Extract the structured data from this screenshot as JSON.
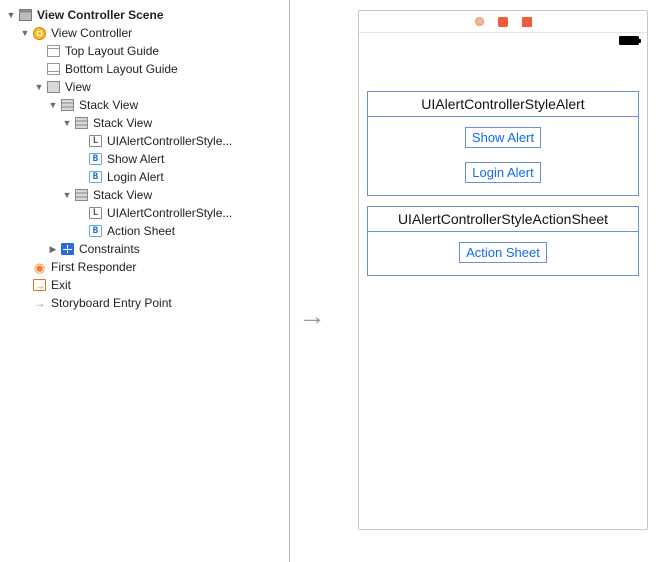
{
  "outline": {
    "scene": "View Controller Scene",
    "vc": "View Controller",
    "topGuide": "Top Layout Guide",
    "bottomGuide": "Bottom Layout Guide",
    "view": "View",
    "stack1": "Stack View",
    "stack1a": "Stack View",
    "stack1a_label": "UIAlertControllerStyle...",
    "stack1a_btn1": "Show Alert",
    "stack1a_btn2": "Login Alert",
    "stack1b": "Stack View",
    "stack1b_label": "UIAlertControllerStyle...",
    "stack1b_btn1": "Action Sheet",
    "constraints": "Constraints",
    "firstResponder": "First Responder",
    "exit": "Exit",
    "entry": "Storyboard Entry Point"
  },
  "canvas": {
    "section1_title": "UIAlertControllerStyleAlert",
    "section1_btn1": "Show Alert",
    "section1_btn2": "Login Alert",
    "section2_title": "UIAlertControllerStyleActionSheet",
    "section2_btn1": "Action Sheet"
  }
}
